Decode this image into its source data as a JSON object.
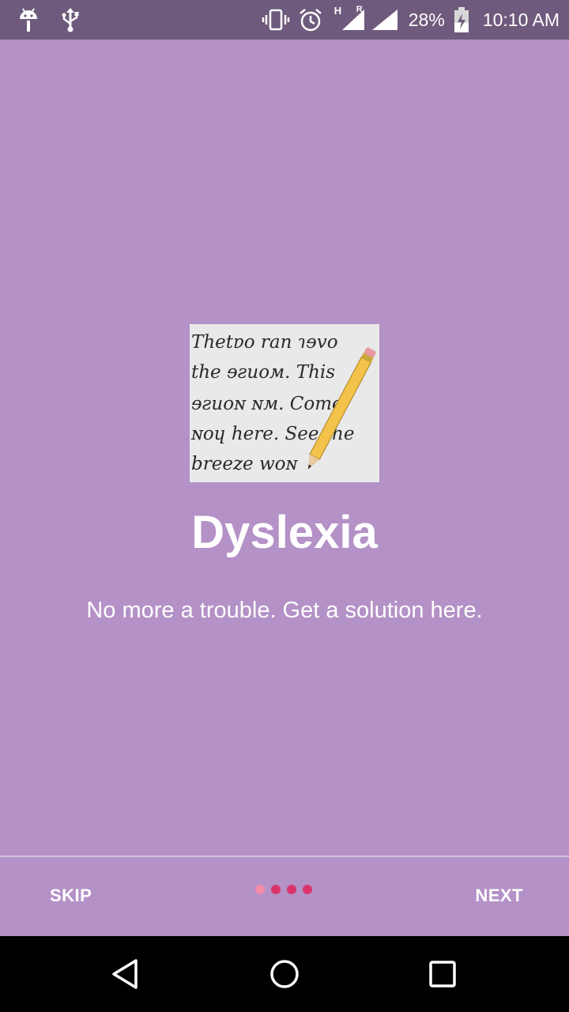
{
  "status_bar": {
    "signal_label_h": "H",
    "signal_label_r": "R",
    "battery": "28%",
    "time": "10:10 AM",
    "icons": [
      "android-debug-icon",
      "usb-icon",
      "vibrate-icon",
      "alarm-icon",
      "signal-icon",
      "battery-charging-icon"
    ]
  },
  "slide": {
    "image_lines": [
      "Thetɐo ran ɿɘvo",
      "the ɘƨиoм. This",
      "ɘƨиoɴ ɴм. Come",
      "ɴoɥ here. See the",
      "breeze woɴ"
    ],
    "title": "Dyslexia",
    "subtitle": "No more a trouble. Get a solution here."
  },
  "onboarding": {
    "skip_label": "SKIP",
    "next_label": "NEXT",
    "pages": 4,
    "current_page": 1,
    "dot_active_color": "#f08ba8",
    "dot_inactive_color": "#d9356a"
  },
  "colors": {
    "background": "#b491c6",
    "status_bar": "#6e5a7c",
    "nav_bar": "#000000"
  },
  "nav": {
    "icons": [
      "back-icon",
      "home-icon",
      "recents-icon"
    ]
  }
}
